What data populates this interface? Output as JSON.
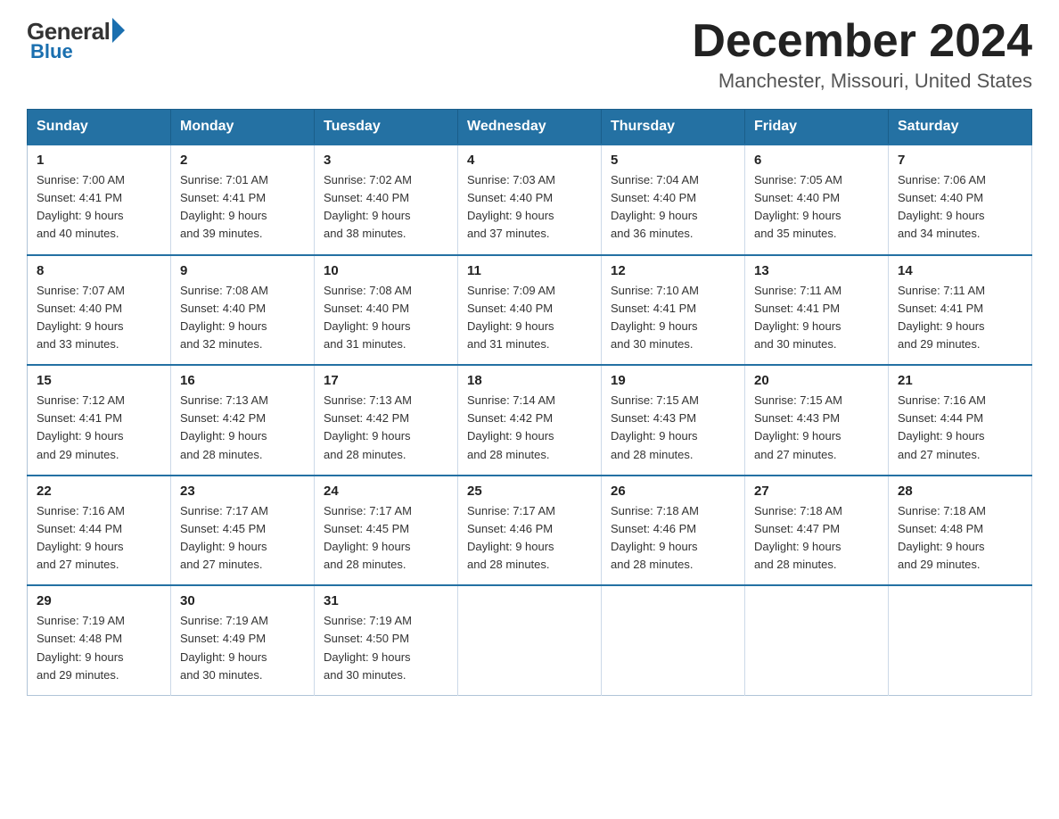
{
  "logo": {
    "general": "General",
    "blue": "Blue"
  },
  "title": "December 2024",
  "location": "Manchester, Missouri, United States",
  "days_of_week": [
    "Sunday",
    "Monday",
    "Tuesday",
    "Wednesday",
    "Thursday",
    "Friday",
    "Saturday"
  ],
  "weeks": [
    [
      {
        "day": "1",
        "sunrise": "7:00 AM",
        "sunset": "4:41 PM",
        "daylight": "9 hours and 40 minutes."
      },
      {
        "day": "2",
        "sunrise": "7:01 AM",
        "sunset": "4:41 PM",
        "daylight": "9 hours and 39 minutes."
      },
      {
        "day": "3",
        "sunrise": "7:02 AM",
        "sunset": "4:40 PM",
        "daylight": "9 hours and 38 minutes."
      },
      {
        "day": "4",
        "sunrise": "7:03 AM",
        "sunset": "4:40 PM",
        "daylight": "9 hours and 37 minutes."
      },
      {
        "day": "5",
        "sunrise": "7:04 AM",
        "sunset": "4:40 PM",
        "daylight": "9 hours and 36 minutes."
      },
      {
        "day": "6",
        "sunrise": "7:05 AM",
        "sunset": "4:40 PM",
        "daylight": "9 hours and 35 minutes."
      },
      {
        "day": "7",
        "sunrise": "7:06 AM",
        "sunset": "4:40 PM",
        "daylight": "9 hours and 34 minutes."
      }
    ],
    [
      {
        "day": "8",
        "sunrise": "7:07 AM",
        "sunset": "4:40 PM",
        "daylight": "9 hours and 33 minutes."
      },
      {
        "day": "9",
        "sunrise": "7:08 AM",
        "sunset": "4:40 PM",
        "daylight": "9 hours and 32 minutes."
      },
      {
        "day": "10",
        "sunrise": "7:08 AM",
        "sunset": "4:40 PM",
        "daylight": "9 hours and 31 minutes."
      },
      {
        "day": "11",
        "sunrise": "7:09 AM",
        "sunset": "4:40 PM",
        "daylight": "9 hours and 31 minutes."
      },
      {
        "day": "12",
        "sunrise": "7:10 AM",
        "sunset": "4:41 PM",
        "daylight": "9 hours and 30 minutes."
      },
      {
        "day": "13",
        "sunrise": "7:11 AM",
        "sunset": "4:41 PM",
        "daylight": "9 hours and 30 minutes."
      },
      {
        "day": "14",
        "sunrise": "7:11 AM",
        "sunset": "4:41 PM",
        "daylight": "9 hours and 29 minutes."
      }
    ],
    [
      {
        "day": "15",
        "sunrise": "7:12 AM",
        "sunset": "4:41 PM",
        "daylight": "9 hours and 29 minutes."
      },
      {
        "day": "16",
        "sunrise": "7:13 AM",
        "sunset": "4:42 PM",
        "daylight": "9 hours and 28 minutes."
      },
      {
        "day": "17",
        "sunrise": "7:13 AM",
        "sunset": "4:42 PM",
        "daylight": "9 hours and 28 minutes."
      },
      {
        "day": "18",
        "sunrise": "7:14 AM",
        "sunset": "4:42 PM",
        "daylight": "9 hours and 28 minutes."
      },
      {
        "day": "19",
        "sunrise": "7:15 AM",
        "sunset": "4:43 PM",
        "daylight": "9 hours and 28 minutes."
      },
      {
        "day": "20",
        "sunrise": "7:15 AM",
        "sunset": "4:43 PM",
        "daylight": "9 hours and 27 minutes."
      },
      {
        "day": "21",
        "sunrise": "7:16 AM",
        "sunset": "4:44 PM",
        "daylight": "9 hours and 27 minutes."
      }
    ],
    [
      {
        "day": "22",
        "sunrise": "7:16 AM",
        "sunset": "4:44 PM",
        "daylight": "9 hours and 27 minutes."
      },
      {
        "day": "23",
        "sunrise": "7:17 AM",
        "sunset": "4:45 PM",
        "daylight": "9 hours and 27 minutes."
      },
      {
        "day": "24",
        "sunrise": "7:17 AM",
        "sunset": "4:45 PM",
        "daylight": "9 hours and 28 minutes."
      },
      {
        "day": "25",
        "sunrise": "7:17 AM",
        "sunset": "4:46 PM",
        "daylight": "9 hours and 28 minutes."
      },
      {
        "day": "26",
        "sunrise": "7:18 AM",
        "sunset": "4:46 PM",
        "daylight": "9 hours and 28 minutes."
      },
      {
        "day": "27",
        "sunrise": "7:18 AM",
        "sunset": "4:47 PM",
        "daylight": "9 hours and 28 minutes."
      },
      {
        "day": "28",
        "sunrise": "7:18 AM",
        "sunset": "4:48 PM",
        "daylight": "9 hours and 29 minutes."
      }
    ],
    [
      {
        "day": "29",
        "sunrise": "7:19 AM",
        "sunset": "4:48 PM",
        "daylight": "9 hours and 29 minutes."
      },
      {
        "day": "30",
        "sunrise": "7:19 AM",
        "sunset": "4:49 PM",
        "daylight": "9 hours and 30 minutes."
      },
      {
        "day": "31",
        "sunrise": "7:19 AM",
        "sunset": "4:50 PM",
        "daylight": "9 hours and 30 minutes."
      },
      null,
      null,
      null,
      null
    ]
  ],
  "labels": {
    "sunrise": "Sunrise:",
    "sunset": "Sunset:",
    "daylight": "Daylight:"
  }
}
